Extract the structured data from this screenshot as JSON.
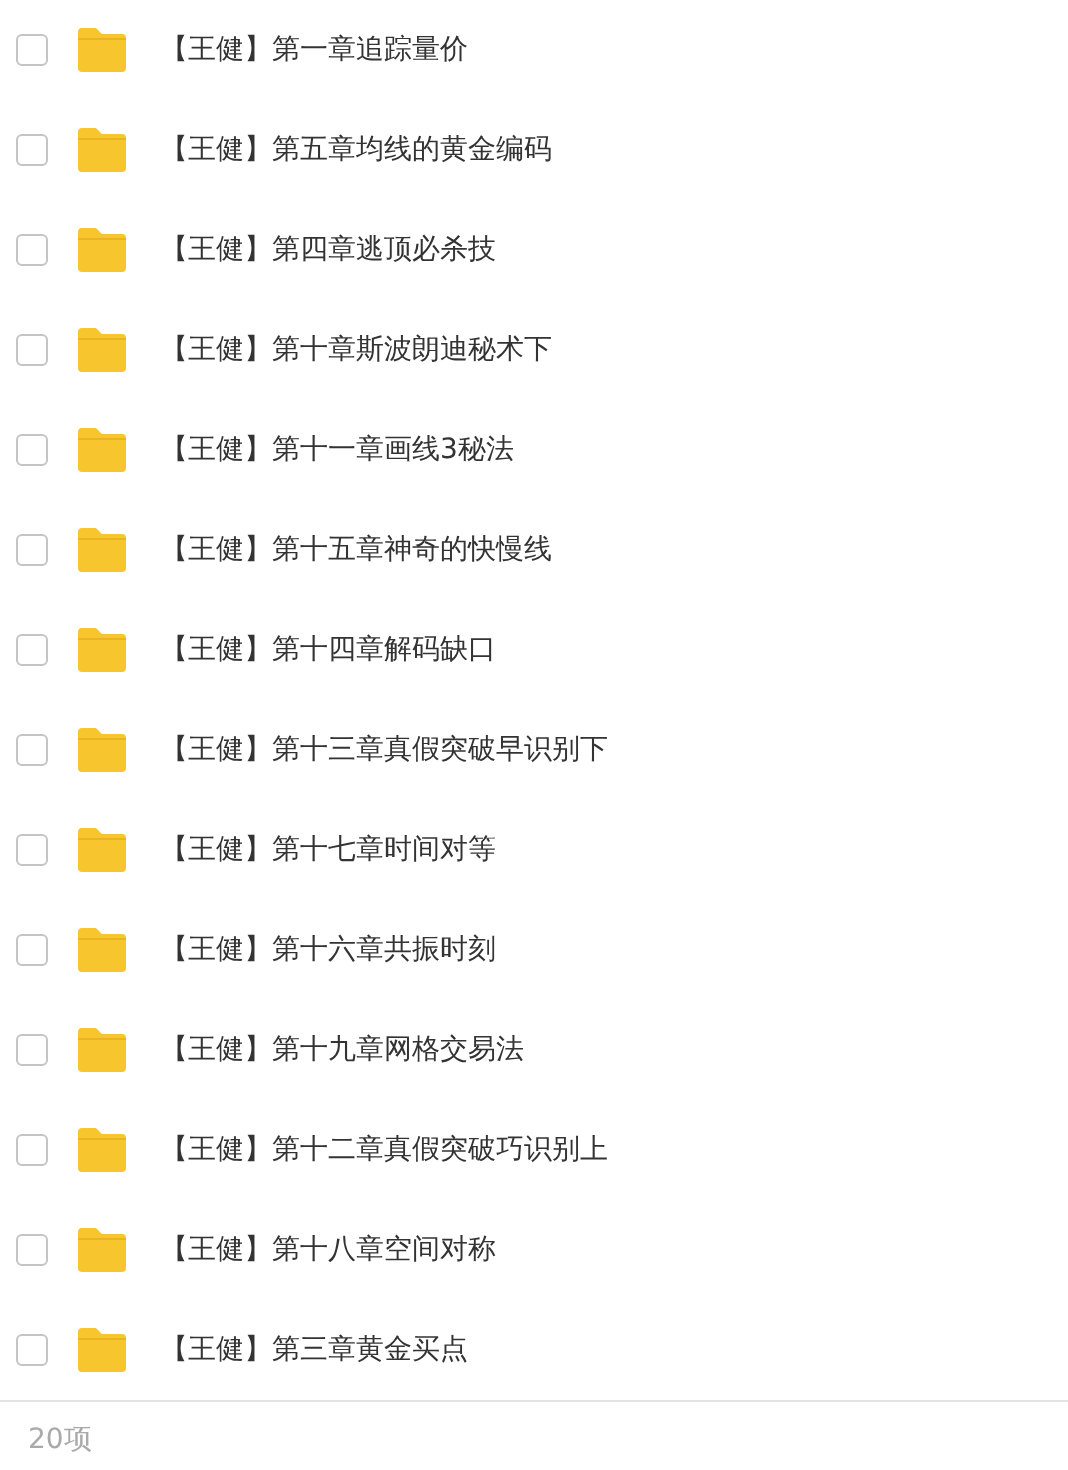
{
  "items": [
    {
      "name": "【王健】第一章追踪量价",
      "checked": false
    },
    {
      "name": "【王健】第五章均线的黄金编码",
      "checked": false
    },
    {
      "name": "【王健】第四章逃顶必杀技",
      "checked": false
    },
    {
      "name": "【王健】第十章斯波朗迪秘术下",
      "checked": false
    },
    {
      "name": "【王健】第十一章画线3秘法",
      "checked": false
    },
    {
      "name": "【王健】第十五章神奇的快慢线",
      "checked": false
    },
    {
      "name": "【王健】第十四章解码缺口",
      "checked": false
    },
    {
      "name": "【王健】第十三章真假突破早识别下",
      "checked": false
    },
    {
      "name": "【王健】第十七章时间对等",
      "checked": false
    },
    {
      "name": "【王健】第十六章共振时刻",
      "checked": false
    },
    {
      "name": "【王健】第十九章网格交易法",
      "checked": false
    },
    {
      "name": "【王健】第十二章真假突破巧识别上",
      "checked": false
    },
    {
      "name": "【王健】第十八章空间对称",
      "checked": false
    },
    {
      "name": "【王健】第三章黄金买点",
      "checked": false
    }
  ],
  "footer": {
    "count": "20项"
  }
}
